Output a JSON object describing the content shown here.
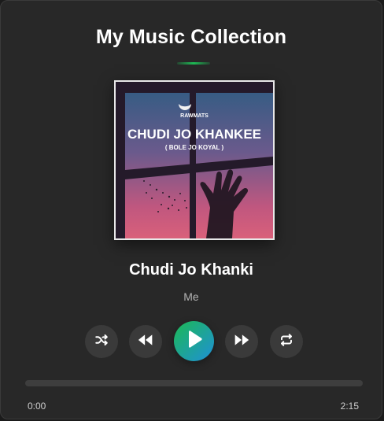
{
  "header": {
    "title": "My Music Collection"
  },
  "track": {
    "title": "Chudi Jo Khanki",
    "artist": "Me",
    "cover": {
      "label_top": "RAWMATS",
      "title": "CHUDI JO KHANKEE",
      "subtitle": "( BOLE JO KOYAL )"
    }
  },
  "controls": {
    "shuffle_icon": "shuffle-icon",
    "previous_icon": "rewind-icon",
    "play_icon": "play-icon",
    "next_icon": "fast-forward-icon",
    "repeat_icon": "repeat-icon"
  },
  "progress": {
    "current": "0:00",
    "total": "2:15",
    "fraction": 0
  },
  "colors": {
    "accent": "#1db954",
    "accent_alt": "#1e90d8",
    "card": "#282828"
  }
}
